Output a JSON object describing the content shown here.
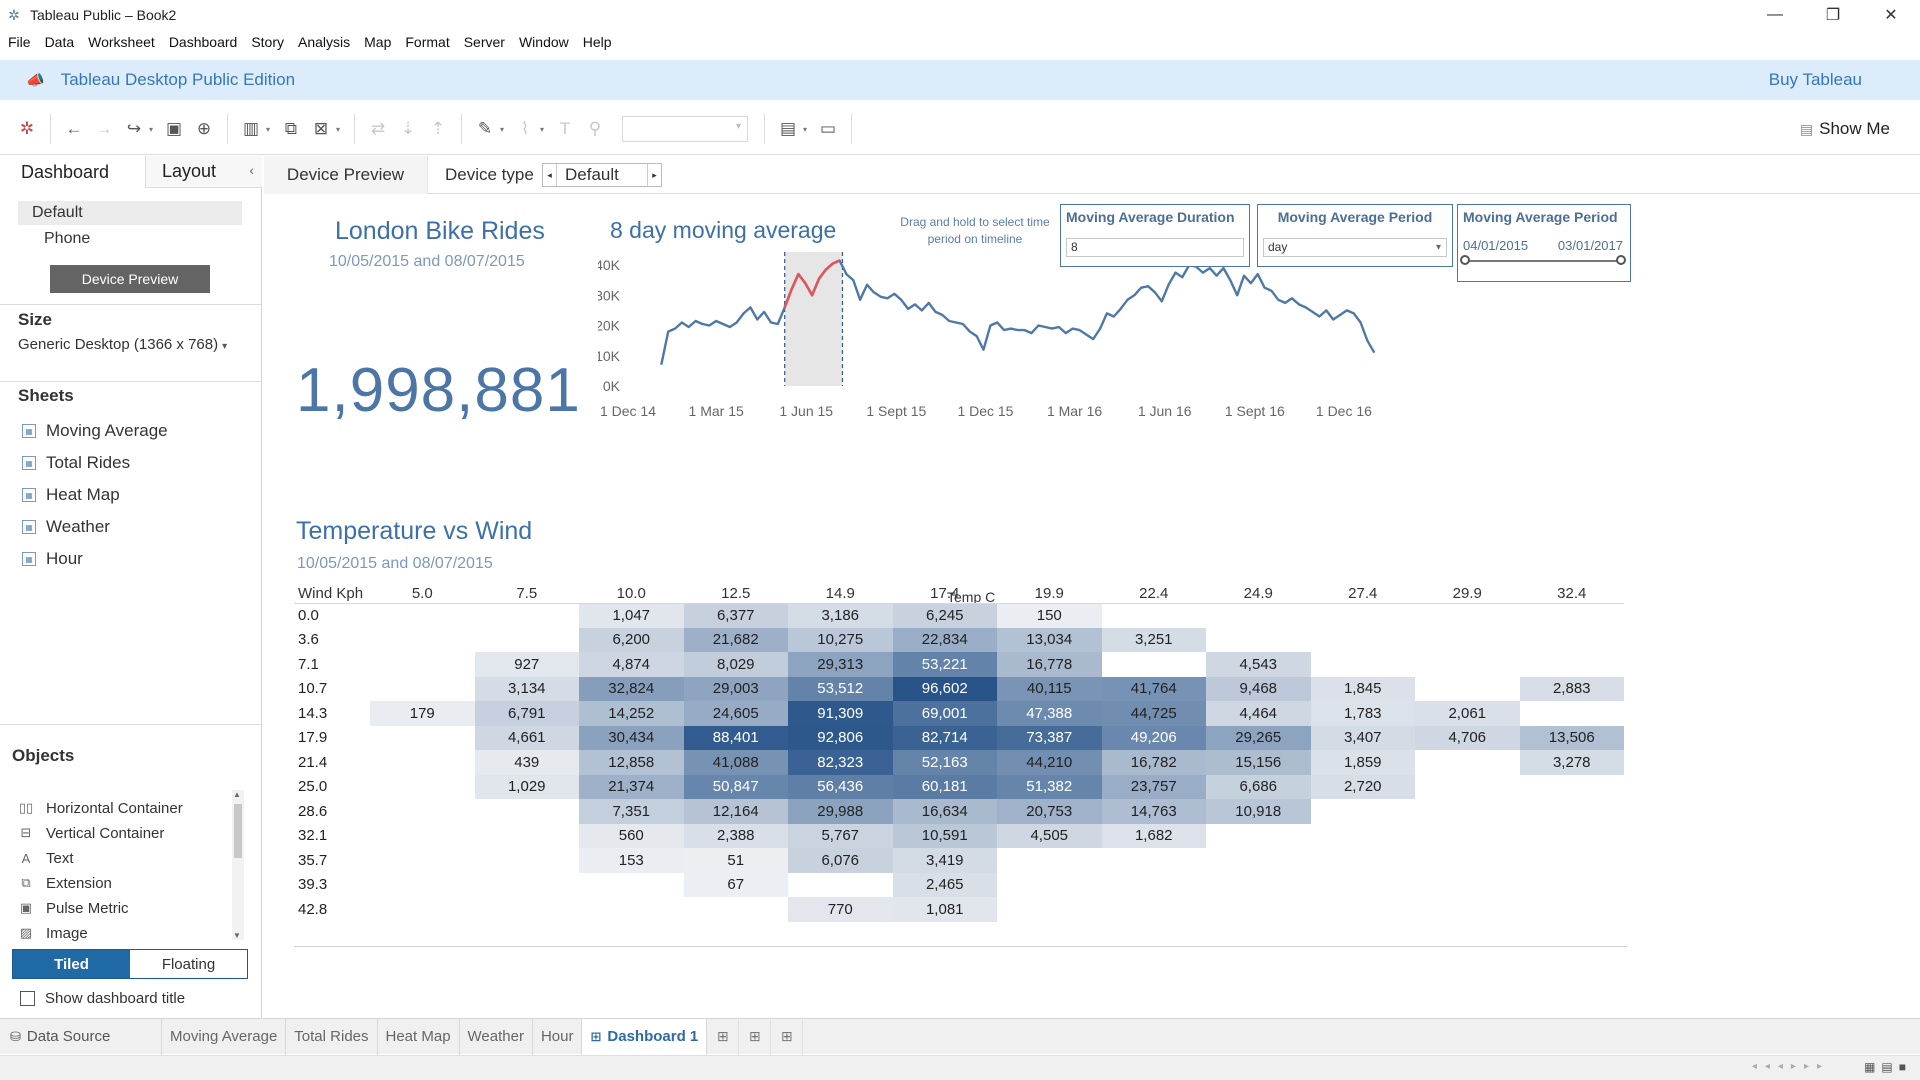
{
  "window": {
    "title": "Tableau Public – Book2"
  },
  "menu": [
    "File",
    "Data",
    "Worksheet",
    "Dashboard",
    "Story",
    "Analysis",
    "Map",
    "Format",
    "Server",
    "Window",
    "Help"
  ],
  "banner": {
    "edition": "Tableau Desktop Public Edition",
    "buy": "Buy Tableau"
  },
  "toolbar": {
    "show_me": "Show Me"
  },
  "left_pane": {
    "tabs": {
      "dashboard": "Dashboard",
      "layout": "Layout"
    },
    "devices": [
      "Default",
      "Phone"
    ],
    "device_preview_button": "Device Preview",
    "size_header": "Size",
    "size_value": "Generic Desktop (1366 x 768)",
    "sheets_header": "Sheets",
    "sheets": [
      "Moving Average",
      "Total Rides",
      "Heat Map",
      "Weather",
      "Hour"
    ],
    "objects_header": "Objects",
    "objects": [
      "Horizontal Container",
      "Vertical Container",
      "Text",
      "Extension",
      "Pulse Metric",
      "Image"
    ],
    "tiled": "Tiled",
    "floating": "Floating",
    "show_title": "Show dashboard title"
  },
  "device_bar": {
    "preview": "Device Preview",
    "type_label": "Device type",
    "type_value": "Default"
  },
  "dashboard": {
    "title": "London Bike Rides",
    "subtitle": "10/05/2015 and 08/07/2015",
    "total": "1,998,881",
    "ma_title": "8 day moving average",
    "hint": "Drag and  hold to select time period on timeline",
    "filters": {
      "duration": {
        "title": "Moving Average Duration",
        "value": "8"
      },
      "period": {
        "title": "Moving Average Period",
        "value": "day"
      },
      "range": {
        "title": "Moving Average Period",
        "start": "04/01/2015",
        "end": "03/01/2017"
      }
    },
    "tw_title": "Temperature vs Wind",
    "tw_subtitle": "10/05/2015 and 08/07/2015"
  },
  "chart_data": [
    {
      "type": "line",
      "title": "8 day moving average",
      "x_ticks": [
        "1 Dec 14",
        "1 Mar 15",
        "1 Jun 15",
        "1 Sept 15",
        "1 Dec 15",
        "1 Mar 16",
        "1 Jun 16",
        "1 Sept 16",
        "1 Dec 16"
      ],
      "y_ticks": [
        "0K",
        "10K",
        "20K",
        "30K",
        "40K"
      ],
      "ylim": [
        0,
        43000
      ],
      "x_range": [
        "2014-12-01",
        "2017-01-15"
      ],
      "highlight_range": [
        "2015-05-10",
        "2015-07-08"
      ],
      "colors": {
        "line": "#4e79a7",
        "highlight": "#e15759",
        "band": "#e6e6e6"
      },
      "series": [
        {
          "x": [
            "2015-01-04",
            "2015-01-11",
            "2015-01-18",
            "2015-01-25",
            "2015-02-01",
            "2015-02-08",
            "2015-02-15",
            "2015-02-22",
            "2015-03-01",
            "2015-03-08",
            "2015-03-15",
            "2015-03-22",
            "2015-03-29",
            "2015-04-05",
            "2015-04-12",
            "2015-04-19",
            "2015-04-26",
            "2015-05-03",
            "2015-05-10",
            "2015-05-17",
            "2015-05-24",
            "2015-05-31",
            "2015-06-07",
            "2015-06-14",
            "2015-06-21",
            "2015-06-28",
            "2015-07-05",
            "2015-07-12",
            "2015-07-19",
            "2015-07-26",
            "2015-08-02",
            "2015-08-09",
            "2015-08-16",
            "2015-08-23",
            "2015-08-30",
            "2015-09-06",
            "2015-09-13",
            "2015-09-20",
            "2015-09-27",
            "2015-10-04",
            "2015-10-11",
            "2015-10-18",
            "2015-10-25",
            "2015-11-01",
            "2015-11-08",
            "2015-11-15",
            "2015-11-22",
            "2015-11-29",
            "2015-12-06",
            "2015-12-13",
            "2015-12-20",
            "2015-12-27",
            "2016-01-03",
            "2016-01-10",
            "2016-01-17",
            "2016-01-24",
            "2016-01-31",
            "2016-02-07",
            "2016-02-14",
            "2016-02-21",
            "2016-02-28",
            "2016-03-06",
            "2016-03-13",
            "2016-03-20",
            "2016-03-27",
            "2016-04-03",
            "2016-04-10",
            "2016-04-17",
            "2016-04-24",
            "2016-05-01",
            "2016-05-08",
            "2016-05-15",
            "2016-05-22",
            "2016-05-29",
            "2016-06-05",
            "2016-06-12",
            "2016-06-19",
            "2016-06-26",
            "2016-07-03",
            "2016-07-10",
            "2016-07-17",
            "2016-07-24",
            "2016-07-31",
            "2016-08-07",
            "2016-08-14",
            "2016-08-21",
            "2016-08-28",
            "2016-09-04",
            "2016-09-11",
            "2016-09-18",
            "2016-09-25",
            "2016-10-02",
            "2016-10-09",
            "2016-10-16",
            "2016-10-23",
            "2016-10-30",
            "2016-11-06",
            "2016-11-13",
            "2016-11-20",
            "2016-11-27",
            "2016-12-04",
            "2016-12-11",
            "2016-12-18",
            "2016-12-25",
            "2017-01-01"
          ],
          "values": [
            7000,
            18000,
            19000,
            21000,
            19500,
            21500,
            20500,
            20000,
            21500,
            20500,
            19500,
            21000,
            24000,
            26000,
            22000,
            24500,
            21000,
            20500,
            26000,
            32000,
            37000,
            34000,
            30000,
            35500,
            38500,
            40500,
            41500,
            37000,
            35000,
            28500,
            33500,
            31000,
            29500,
            29000,
            30500,
            28500,
            25500,
            27000,
            25000,
            27500,
            24500,
            23500,
            21500,
            21000,
            20500,
            18000,
            16500,
            12000,
            20000,
            21000,
            18500,
            19000,
            18500,
            18500,
            17500,
            20000,
            19500,
            19000,
            19500,
            17500,
            19000,
            18500,
            17000,
            15500,
            19000,
            24000,
            23000,
            25500,
            28500,
            30000,
            32500,
            33000,
            31000,
            28000,
            33500,
            37500,
            36000,
            40000,
            39500,
            37500,
            39000,
            36500,
            39000,
            35000,
            30000,
            36500,
            34000,
            37000,
            32500,
            31500,
            28500,
            27500,
            29000,
            27000,
            26000,
            24500,
            23000,
            25000,
            22000,
            23500,
            25000,
            24000,
            21000,
            15000,
            11000
          ]
        }
      ]
    },
    {
      "type": "heatmap",
      "title": "Temperature vs Wind",
      "col_header": "Temp C",
      "row_header": "Wind Kph",
      "x": [
        "5.0",
        "7.5",
        "10.0",
        "12.5",
        "14.9",
        "17.4",
        "19.9",
        "22.4",
        "24.9",
        "27.4",
        "29.9",
        "32.4"
      ],
      "y": [
        "0.0",
        "3.6",
        "7.1",
        "10.7",
        "14.3",
        "17.9",
        "21.4",
        "25.0",
        "28.6",
        "32.1",
        "35.7",
        "39.3",
        "42.8"
      ],
      "values": [
        [
          null,
          null,
          1047,
          6377,
          3186,
          6245,
          150,
          null,
          null,
          null,
          null,
          null
        ],
        [
          null,
          null,
          6200,
          21682,
          10275,
          22834,
          13034,
          3251,
          null,
          null,
          null,
          null
        ],
        [
          null,
          927,
          4874,
          8029,
          29313,
          53221,
          16778,
          null,
          4543,
          null,
          null,
          null
        ],
        [
          null,
          3134,
          32824,
          29003,
          53512,
          96602,
          40115,
          41764,
          9468,
          1845,
          null,
          2883
        ],
        [
          179,
          6791,
          14252,
          24605,
          91309,
          69001,
          47388,
          44725,
          4464,
          1783,
          2061,
          null
        ],
        [
          null,
          4661,
          30434,
          88401,
          92806,
          82714,
          73387,
          49206,
          29265,
          3407,
          4706,
          13506
        ],
        [
          null,
          439,
          12858,
          41088,
          82323,
          52163,
          44210,
          16782,
          15156,
          1859,
          null,
          3278
        ],
        [
          null,
          1029,
          21374,
          50847,
          56436,
          60181,
          51382,
          23757,
          6686,
          2720,
          null,
          null
        ],
        [
          null,
          null,
          7351,
          12164,
          29988,
          16634,
          20753,
          14763,
          10918,
          null,
          null,
          null
        ],
        [
          null,
          null,
          560,
          2388,
          5767,
          10591,
          4505,
          1682,
          null,
          null,
          null,
          null
        ],
        [
          null,
          null,
          153,
          51,
          6076,
          3419,
          null,
          null,
          null,
          null,
          null,
          null
        ],
        [
          null,
          null,
          null,
          67,
          null,
          2465,
          null,
          null,
          null,
          null,
          null,
          null
        ],
        [
          null,
          null,
          null,
          null,
          770,
          1081,
          null,
          null,
          null,
          null,
          null,
          null
        ]
      ]
    }
  ],
  "bottom_tabs": {
    "data_source": "Data Source",
    "sheets": [
      "Moving Average",
      "Total Rides",
      "Heat Map",
      "Weather",
      "Hour"
    ],
    "active": "Dashboard 1"
  }
}
